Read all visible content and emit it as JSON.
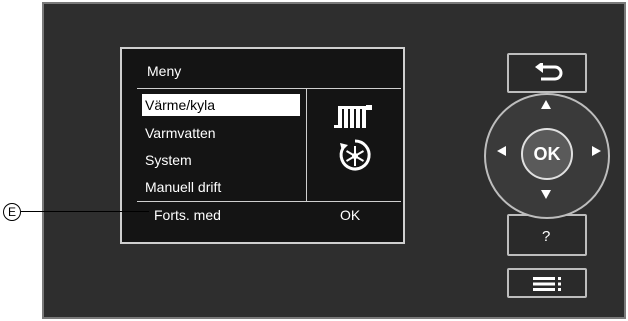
{
  "screen": {
    "title": "Meny",
    "menu_items": [
      {
        "label": "Värme/kyla",
        "selected": true
      },
      {
        "label": "Varmvatten",
        "selected": false
      },
      {
        "label": "System",
        "selected": false
      },
      {
        "label": "Manuell drift",
        "selected": false
      }
    ],
    "softkey_left": "Forts. med",
    "softkey_right": "OK",
    "icons": [
      "radiator-icon",
      "snowflake-cycle-icon"
    ]
  },
  "callout": {
    "letter": "E"
  },
  "controls": {
    "ok_label": "OK",
    "help_label": "?",
    "icons": [
      "back-arrow-icon",
      "up-arrow-icon",
      "down-arrow-icon",
      "left-arrow-icon",
      "right-arrow-icon",
      "menu-icon"
    ]
  },
  "colors": {
    "panel": "#2e2e2e",
    "screen": "#141414",
    "border": "#bdbdbd",
    "selected_bg": "#ffffff"
  }
}
